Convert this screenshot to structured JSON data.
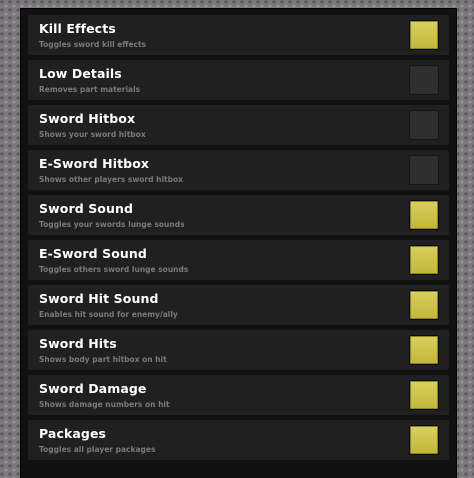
{
  "settings": {
    "items": [
      {
        "title": "Kill Effects",
        "description": "Toggles sword kill effects",
        "enabled": true
      },
      {
        "title": "Low Details",
        "description": "Removes part materials",
        "enabled": false
      },
      {
        "title": "Sword Hitbox",
        "description": "Shows your sword hitbox",
        "enabled": false
      },
      {
        "title": "E-Sword Hitbox",
        "description": "Shows other players sword hitbox",
        "enabled": false
      },
      {
        "title": "Sword Sound",
        "description": "Toggles your swords lunge sounds",
        "enabled": true
      },
      {
        "title": "E-Sword Sound",
        "description": "Toggles others sword lunge sounds",
        "enabled": true
      },
      {
        "title": "Sword Hit Sound",
        "description": "Enables hit sound for enemy/ally",
        "enabled": true
      },
      {
        "title": "Sword Hits",
        "description": "Shows body part hitbox on hit",
        "enabled": true
      },
      {
        "title": "Sword Damage",
        "description": "Shows damage numbers on hit",
        "enabled": true
      },
      {
        "title": "Packages",
        "description": "Toggles all player packages",
        "enabled": true
      }
    ]
  },
  "colors": {
    "toggle_on": "#cfc44a",
    "toggle_off": "#2f2f2f",
    "row_background": "#202020",
    "panel_background": "#111111"
  }
}
